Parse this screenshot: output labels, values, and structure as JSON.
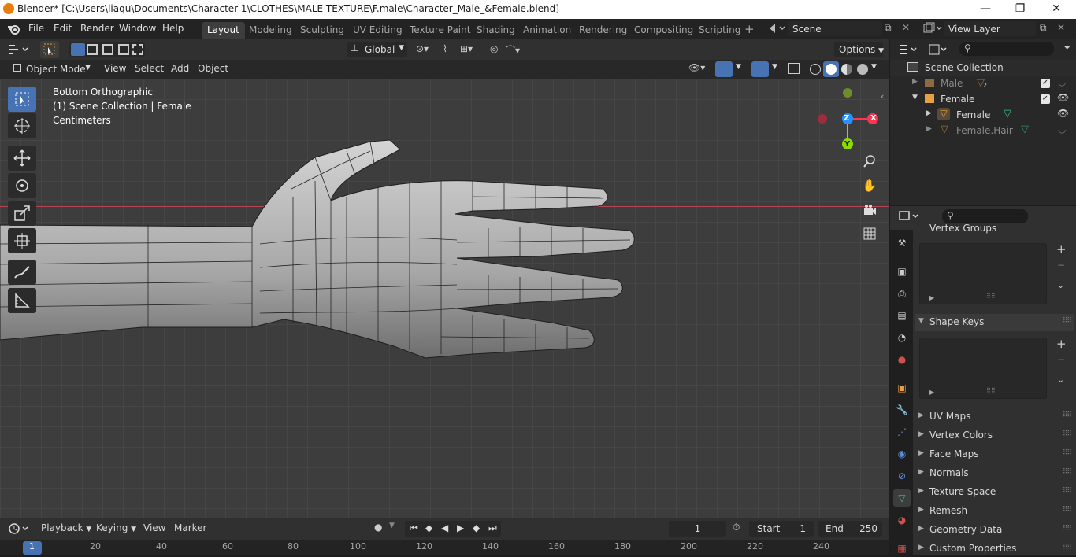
{
  "titlebar": {
    "title": "Blender* [C:\\Users\\liaqu\\Documents\\Character 1\\CLOTHES\\MALE TEXTURE\\F.male\\Character_Male_&Female.blend]",
    "minimize": "—",
    "maximize": "❐",
    "close": "✕"
  },
  "menu": [
    "File",
    "Edit",
    "Render",
    "Window",
    "Help"
  ],
  "workspaces": [
    "Layout",
    "Modeling",
    "Sculpting",
    "UV Editing",
    "Texture Paint",
    "Shading",
    "Animation",
    "Rendering",
    "Compositing",
    "Scripting"
  ],
  "active_workspace": "Layout",
  "scene": {
    "name": "Scene"
  },
  "view_layer": {
    "name": "View Layer"
  },
  "toolbar": {
    "orientation": "Global",
    "options": "Options"
  },
  "viewport_header": {
    "mode": "Object Mode",
    "view": "View",
    "select": "Select",
    "add": "Add",
    "object": "Object"
  },
  "viewport": {
    "view_name": "Bottom Orthographic",
    "collection": "(1) Scene Collection | Female",
    "units": "Centimeters"
  },
  "gizmo": {
    "x": "X",
    "y": "Y",
    "z": "Z"
  },
  "outliner": {
    "root": "Scene Collection",
    "items": [
      {
        "name": "Male",
        "badge": "2"
      },
      {
        "name": "Female"
      },
      {
        "name": "Female"
      },
      {
        "name": "Female.Hair"
      }
    ]
  },
  "properties": {
    "sections": [
      "Vertex Groups",
      "Shape Keys",
      "UV Maps",
      "Vertex Colors",
      "Face Maps",
      "Normals",
      "Texture Space",
      "Remesh",
      "Geometry Data",
      "Custom Properties"
    ]
  },
  "timeline": {
    "playback": "Playback",
    "keying": "Keying",
    "view": "View",
    "marker": "Marker",
    "current_frame": "1",
    "start_label": "Start",
    "start": "1",
    "end_label": "End",
    "end": "250",
    "ruler": [
      "1",
      "20",
      "40",
      "60",
      "80",
      "100",
      "120",
      "140",
      "160",
      "180",
      "200",
      "220",
      "240"
    ]
  },
  "colors": {
    "accent": "#4772b3",
    "axis_x": "#ff3352",
    "axis_y": "#8bdc00",
    "axis_z": "#2890ff",
    "collection": "#e8a045"
  }
}
